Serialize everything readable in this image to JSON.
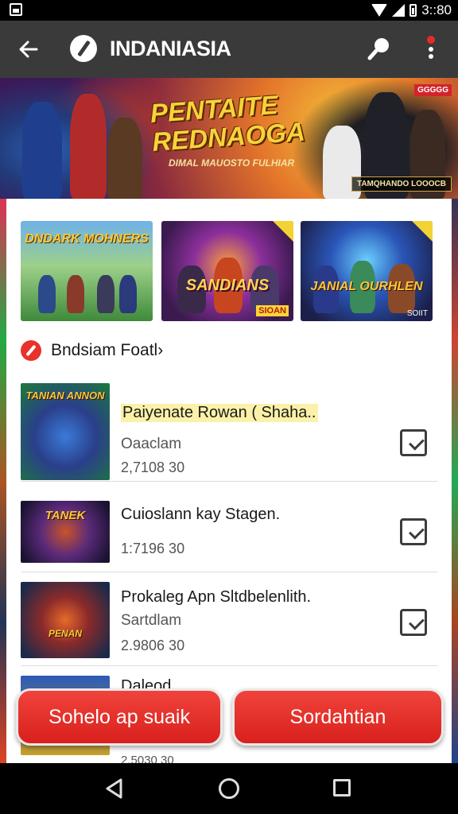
{
  "status_bar": {
    "time": "3::80"
  },
  "app_bar": {
    "title": "INDANIASIA"
  },
  "banner": {
    "title": "PENTAITE REDNAOGA",
    "subtitle": "DIMAL  MAUOSTO FULHIAR",
    "badge_top": "GGGGG",
    "badge_bottom": "TAMQHANDO LOOOCB"
  },
  "featured": [
    {
      "label": "DNDARK MOHNERS",
      "footer": "",
      "bg": "#6fb2e8"
    },
    {
      "label": "SANDIANS",
      "footer": "SIOAN",
      "bg": "#8c2f9b"
    },
    {
      "label": "JANIAL OURHLEN",
      "footer": "SOIIT",
      "bg": "#2a56b8"
    }
  ],
  "section": {
    "title": "Bndsiam Foatl›"
  },
  "list": [
    {
      "thumb_label": "TANIAN ANNON",
      "title": "Paiyenate Rowan ( Shaha..",
      "highlight": true,
      "subtitle": "Oaaclam",
      "meta": "2,7108 30"
    },
    {
      "thumb_label": "TANEK",
      "title": "Cuioslann kay Stagen.",
      "highlight": false,
      "subtitle": "",
      "meta": "1:7196 30"
    },
    {
      "thumb_label": "PENAN",
      "title": "Prokaleg Apn Sltdbelenlith.",
      "highlight": false,
      "subtitle": "Sartdlam",
      "meta": "2.9806 30"
    },
    {
      "thumb_label": "",
      "title": "Daleod",
      "highlight": false,
      "subtitle": "",
      "meta": "2.5030 30"
    }
  ],
  "buttons": {
    "left_label": "Sohelo ap suaik",
    "right_label": "Sordahtian"
  },
  "colors": {
    "accent": "#e0282a",
    "app_bar": "#3a3a3a"
  }
}
